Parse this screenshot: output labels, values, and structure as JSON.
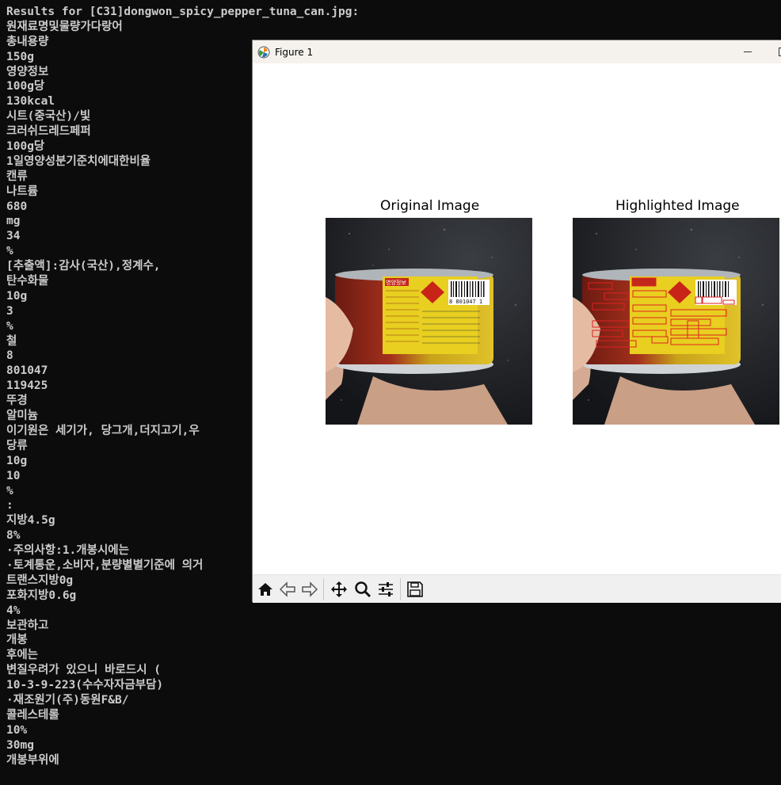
{
  "terminal": {
    "lines": [
      "Results for [C31]dongwon_spicy_pepper_tuna_can.jpg:",
      "원재료명및물량가다랑어",
      "총내용량",
      "150g",
      "영양정보",
      "100g당",
      "130kcal",
      "시트(중국산)/빛",
      "크러쉬드레드페퍼",
      "100g당",
      "1일영양성분기준치에대한비율",
      "캔류",
      "나트륨",
      "680",
      "mg",
      "34",
      "%",
      "[추출액]:감사(국산),정계수,",
      "탄수화물",
      "10g",
      "3",
      "%",
      "철",
      "8",
      "801047",
      "119425",
      "뚜경",
      "알미늄",
      "이기원은 세기가, 당그개,더지고기,우",
      "당류",
      "10g",
      "10",
      "%",
      ":",
      "지방4.5g",
      "8%",
      "·주의사항:1.개봉시에는",
      "·토계통운,소비자,분량별별기준에 의거",
      "트랜스지방0g",
      "포화지방0.6g",
      "4%",
      "보관하고",
      "개봉",
      "후에는",
      "변질우려가 있으니 바로드시 (",
      "10-3-9-223(수수자자금부담)",
      "·재조원기(주)동원F&B/",
      "콜레스테롤",
      "10%",
      "30mg",
      "개봉부위에"
    ]
  },
  "figure": {
    "title": "Figure 1",
    "left_title": "Original Image",
    "right_title": "Highlighted Image",
    "can_text": {
      "panel_header": "영양정보",
      "barcode_number": "8 801047 1"
    },
    "toolbar": [
      {
        "name": "home-icon",
        "label": "Home"
      },
      {
        "name": "back-icon",
        "label": "Back"
      },
      {
        "name": "forward-icon",
        "label": "Forward"
      },
      {
        "name": "pan-icon",
        "label": "Pan"
      },
      {
        "name": "zoom-icon",
        "label": "Zoom"
      },
      {
        "name": "configure-subplots-icon",
        "label": "Configure subplots"
      },
      {
        "name": "save-icon",
        "label": "Save"
      }
    ]
  },
  "colors": {
    "terminal_bg": "#0c0c0c",
    "terminal_text": "#cccccc",
    "highlight_box": "#e02020"
  }
}
